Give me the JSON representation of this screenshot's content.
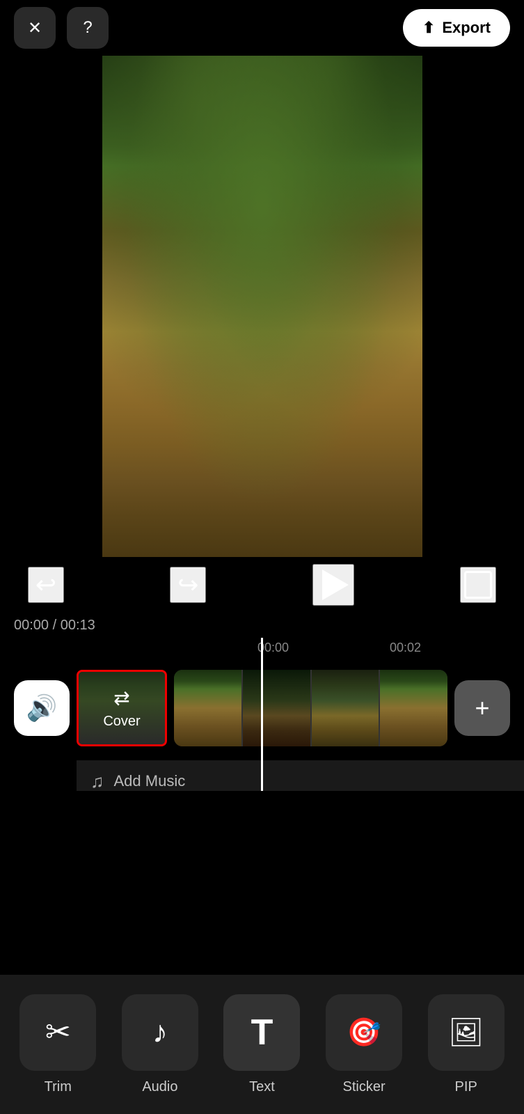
{
  "header": {
    "close_label": "✕",
    "help_label": "?",
    "export_label": "Export"
  },
  "controls": {
    "undo_label": "↩",
    "redo_label": "↪",
    "play_label": "▶",
    "fullscreen_label": "⛶"
  },
  "timeline": {
    "current_time": "00:00",
    "total_time": "00:13",
    "separator": "/",
    "mark1": "00:00",
    "mark2": "00:02"
  },
  "track": {
    "cover_label": "Cover",
    "add_music_label": "Add Music"
  },
  "toolbar": {
    "items": [
      {
        "id": "trim",
        "label": "Trim",
        "icon": "✂"
      },
      {
        "id": "audio",
        "label": "Audio",
        "icon": "♪"
      },
      {
        "id": "text",
        "label": "Text",
        "icon": "T"
      },
      {
        "id": "sticker",
        "label": "Sticker",
        "icon": "🎯"
      },
      {
        "id": "pip",
        "label": "PIP",
        "icon": "🖼"
      }
    ]
  }
}
